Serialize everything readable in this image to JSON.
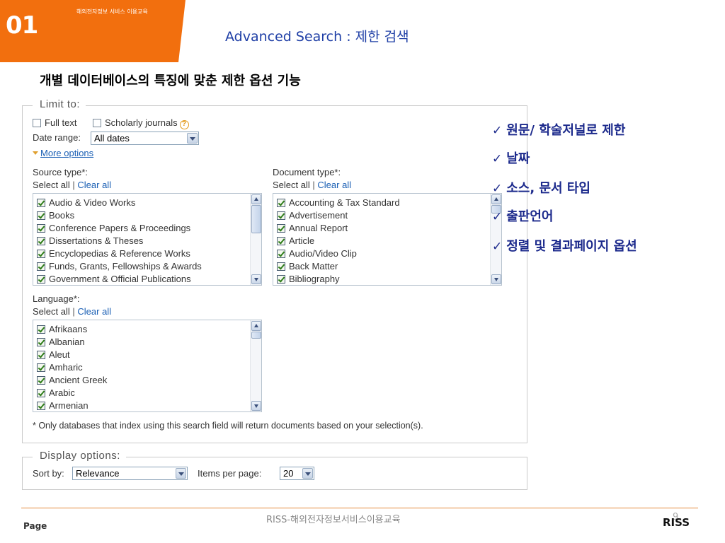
{
  "slide": {
    "number": "01",
    "course_label": "해외전자정보 서비스 이용교육",
    "title": "Advanced Search : 제한 검색",
    "subtitle": "개별 데이터베이스의 특징에 맞춘 제한 옵션 기능"
  },
  "limit": {
    "legend": "Limit to:",
    "full_text": "Full text",
    "scholarly": "Scholarly journals",
    "help_glyph": "?",
    "date_range_label": "Date range:",
    "date_range_value": "All dates",
    "more_options": "More options"
  },
  "source_type": {
    "label": "Source type*:",
    "select_all": "Select all",
    "separator": "|",
    "clear_all": "Clear all",
    "items": [
      "Audio & Video Works",
      "Books",
      "Conference Papers & Proceedings",
      "Dissertations & Theses",
      "Encyclopedias & Reference Works",
      "Funds, Grants, Fellowships & Awards",
      "Government & Official Publications"
    ]
  },
  "document_type": {
    "label": "Document type*:",
    "select_all": "Select all",
    "separator": "|",
    "clear_all": "Clear all",
    "items": [
      "Accounting & Tax Standard",
      "Advertisement",
      "Annual Report",
      "Article",
      "Audio/Video Clip",
      "Back Matter",
      "Bibliography"
    ]
  },
  "language": {
    "label": "Language*:",
    "select_all": "Select all",
    "separator": "|",
    "clear_all": "Clear all",
    "items": [
      "Afrikaans",
      "Albanian",
      "Aleut",
      "Amharic",
      "Ancient Greek",
      "Arabic",
      "Armenian"
    ]
  },
  "note": "* Only databases that index using this search field will return documents based on your selection(s).",
  "display": {
    "legend": "Display options:",
    "sort_label": "Sort by:",
    "sort_value": "Relevance",
    "items_label": "Items per page:",
    "items_value": "20"
  },
  "annotations": {
    "check_glyph": "✓",
    "items": [
      "원문/ 학술저널로 제한",
      "날짜",
      "소스, 문서 타입",
      "출판언어",
      "정렬 및 결과페이지 옵션"
    ]
  },
  "footer": {
    "page_label": "Page",
    "center_text": "RISS-해외전자정보서비스이용교육",
    "page_number": "9",
    "logo_text": "RISS"
  },
  "colors": {
    "orange": "#f26f0e",
    "title_blue": "#1f3fa6",
    "annotation_blue": "#1c2a8c",
    "link_blue": "#1a5fb4"
  }
}
